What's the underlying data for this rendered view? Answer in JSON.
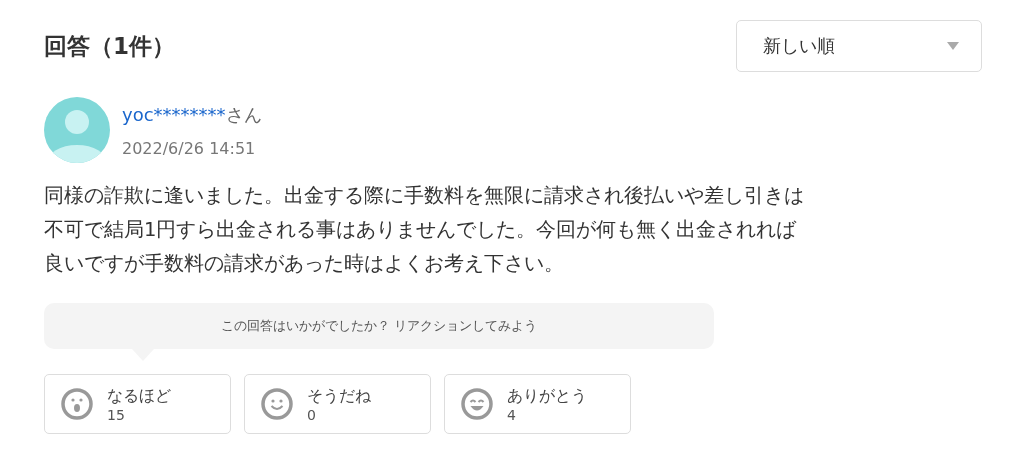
{
  "heading": "回答（1件）",
  "sort": {
    "value": "新しい順"
  },
  "answer": {
    "user": "yoc********",
    "honorific": "さん",
    "date": "2022/6/26 14:51",
    "lines": [
      "同様の詐欺に逢いました。出金する際に手数料を無限に請求され後払いや差し引きは",
      "不可で結局1円すら出金される事はありませんでした。今回が何も無く出金されれば",
      "良いですが手数料の請求があった時はよくお考え下さい。"
    ]
  },
  "prompt": "この回答はいかがでしたか？ リアクションしてみよう",
  "reactions": [
    {
      "kind": "surprised",
      "label": "なるほど",
      "count": "15"
    },
    {
      "kind": "smile",
      "label": "そうだね",
      "count": "0"
    },
    {
      "kind": "grin",
      "label": "ありがとう",
      "count": "4"
    }
  ]
}
